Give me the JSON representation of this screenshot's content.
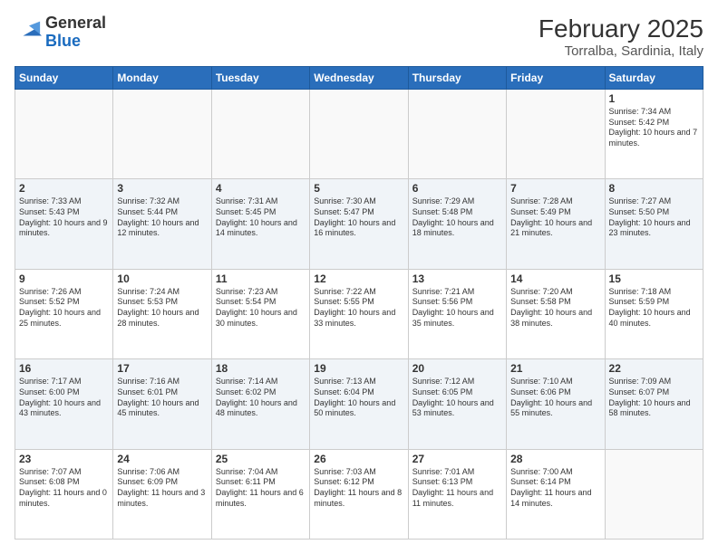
{
  "header": {
    "logo_general": "General",
    "logo_blue": "Blue",
    "month_year": "February 2025",
    "location": "Torralba, Sardinia, Italy"
  },
  "days_of_week": [
    "Sunday",
    "Monday",
    "Tuesday",
    "Wednesday",
    "Thursday",
    "Friday",
    "Saturday"
  ],
  "weeks": [
    [
      {
        "day": "",
        "info": ""
      },
      {
        "day": "",
        "info": ""
      },
      {
        "day": "",
        "info": ""
      },
      {
        "day": "",
        "info": ""
      },
      {
        "day": "",
        "info": ""
      },
      {
        "day": "",
        "info": ""
      },
      {
        "day": "1",
        "info": "Sunrise: 7:34 AM\nSunset: 5:42 PM\nDaylight: 10 hours and 7 minutes."
      }
    ],
    [
      {
        "day": "2",
        "info": "Sunrise: 7:33 AM\nSunset: 5:43 PM\nDaylight: 10 hours and 9 minutes."
      },
      {
        "day": "3",
        "info": "Sunrise: 7:32 AM\nSunset: 5:44 PM\nDaylight: 10 hours and 12 minutes."
      },
      {
        "day": "4",
        "info": "Sunrise: 7:31 AM\nSunset: 5:45 PM\nDaylight: 10 hours and 14 minutes."
      },
      {
        "day": "5",
        "info": "Sunrise: 7:30 AM\nSunset: 5:47 PM\nDaylight: 10 hours and 16 minutes."
      },
      {
        "day": "6",
        "info": "Sunrise: 7:29 AM\nSunset: 5:48 PM\nDaylight: 10 hours and 18 minutes."
      },
      {
        "day": "7",
        "info": "Sunrise: 7:28 AM\nSunset: 5:49 PM\nDaylight: 10 hours and 21 minutes."
      },
      {
        "day": "8",
        "info": "Sunrise: 7:27 AM\nSunset: 5:50 PM\nDaylight: 10 hours and 23 minutes."
      }
    ],
    [
      {
        "day": "9",
        "info": "Sunrise: 7:26 AM\nSunset: 5:52 PM\nDaylight: 10 hours and 25 minutes."
      },
      {
        "day": "10",
        "info": "Sunrise: 7:24 AM\nSunset: 5:53 PM\nDaylight: 10 hours and 28 minutes."
      },
      {
        "day": "11",
        "info": "Sunrise: 7:23 AM\nSunset: 5:54 PM\nDaylight: 10 hours and 30 minutes."
      },
      {
        "day": "12",
        "info": "Sunrise: 7:22 AM\nSunset: 5:55 PM\nDaylight: 10 hours and 33 minutes."
      },
      {
        "day": "13",
        "info": "Sunrise: 7:21 AM\nSunset: 5:56 PM\nDaylight: 10 hours and 35 minutes."
      },
      {
        "day": "14",
        "info": "Sunrise: 7:20 AM\nSunset: 5:58 PM\nDaylight: 10 hours and 38 minutes."
      },
      {
        "day": "15",
        "info": "Sunrise: 7:18 AM\nSunset: 5:59 PM\nDaylight: 10 hours and 40 minutes."
      }
    ],
    [
      {
        "day": "16",
        "info": "Sunrise: 7:17 AM\nSunset: 6:00 PM\nDaylight: 10 hours and 43 minutes."
      },
      {
        "day": "17",
        "info": "Sunrise: 7:16 AM\nSunset: 6:01 PM\nDaylight: 10 hours and 45 minutes."
      },
      {
        "day": "18",
        "info": "Sunrise: 7:14 AM\nSunset: 6:02 PM\nDaylight: 10 hours and 48 minutes."
      },
      {
        "day": "19",
        "info": "Sunrise: 7:13 AM\nSunset: 6:04 PM\nDaylight: 10 hours and 50 minutes."
      },
      {
        "day": "20",
        "info": "Sunrise: 7:12 AM\nSunset: 6:05 PM\nDaylight: 10 hours and 53 minutes."
      },
      {
        "day": "21",
        "info": "Sunrise: 7:10 AM\nSunset: 6:06 PM\nDaylight: 10 hours and 55 minutes."
      },
      {
        "day": "22",
        "info": "Sunrise: 7:09 AM\nSunset: 6:07 PM\nDaylight: 10 hours and 58 minutes."
      }
    ],
    [
      {
        "day": "23",
        "info": "Sunrise: 7:07 AM\nSunset: 6:08 PM\nDaylight: 11 hours and 0 minutes."
      },
      {
        "day": "24",
        "info": "Sunrise: 7:06 AM\nSunset: 6:09 PM\nDaylight: 11 hours and 3 minutes."
      },
      {
        "day": "25",
        "info": "Sunrise: 7:04 AM\nSunset: 6:11 PM\nDaylight: 11 hours and 6 minutes."
      },
      {
        "day": "26",
        "info": "Sunrise: 7:03 AM\nSunset: 6:12 PM\nDaylight: 11 hours and 8 minutes."
      },
      {
        "day": "27",
        "info": "Sunrise: 7:01 AM\nSunset: 6:13 PM\nDaylight: 11 hours and 11 minutes."
      },
      {
        "day": "28",
        "info": "Sunrise: 7:00 AM\nSunset: 6:14 PM\nDaylight: 11 hours and 14 minutes."
      },
      {
        "day": "",
        "info": ""
      }
    ]
  ]
}
